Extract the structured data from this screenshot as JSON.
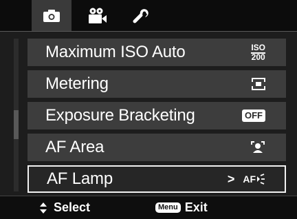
{
  "tabs": [
    {
      "icon": "camera-icon",
      "active": true
    },
    {
      "icon": "video-camera-icon",
      "active": false
    },
    {
      "icon": "wrench-icon",
      "active": false
    }
  ],
  "menu": {
    "items": [
      {
        "label": "Maximum ISO Auto",
        "value_top": "ISO",
        "value_bottom": "200"
      },
      {
        "label": "Metering",
        "value_icon": "center-weighted-metering-icon"
      },
      {
        "label": "Exposure Bracketing",
        "value": "OFF"
      },
      {
        "label": "AF Area",
        "value_icon": "face-detection-icon"
      },
      {
        "label": "AF Lamp",
        "value": "AF",
        "value_icon": "af-lamp-icon",
        "selected": true
      }
    ],
    "arrow": ">"
  },
  "bottom": {
    "select_label": "Select",
    "menu_key": "Menu",
    "exit_label": "Exit"
  },
  "colors": {
    "background": "#1d1d1d",
    "item": "#3d3d3d",
    "selected_border": "#f2f2f2",
    "text": "#ffffff"
  }
}
